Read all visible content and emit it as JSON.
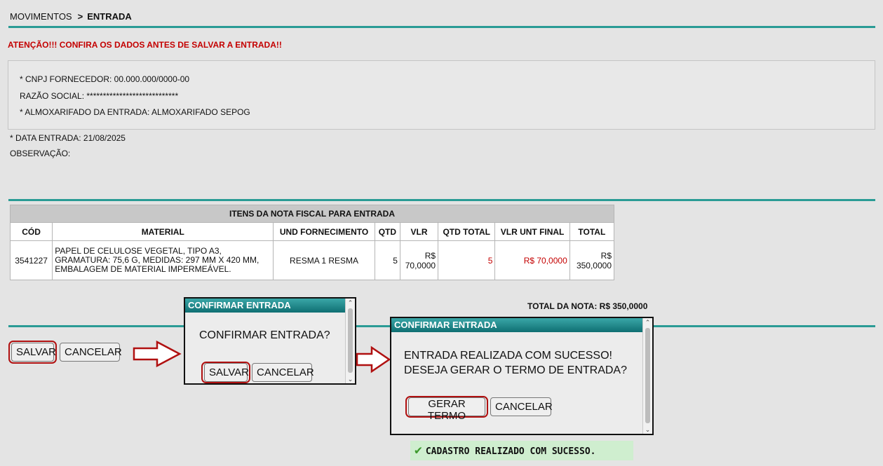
{
  "breadcrumb": {
    "root": "MOVIMENTOS",
    "separator": ">",
    "current": "ENTRADA"
  },
  "warning": "ATENÇÃO!!! CONFIRA OS DADOS ANTES DE SALVAR A ENTRADA!!",
  "info": {
    "cnpj": "* CNPJ FORNECEDOR: 00.000.000/0000-00",
    "razao_social": "RAZÃO SOCIAL: ****************************",
    "almoxarifado": "* ALMOXARIFADO DA ENTRADA: ALMOXARIFADO SEPOG"
  },
  "data_entrada": "* DATA ENTRADA: 21/08/2025",
  "observacao": "OBSERVAÇÃO:",
  "table": {
    "caption": "ITENS DA NOTA FISCAL PARA ENTRADA",
    "headers": [
      "CÓD",
      "MATERIAL",
      "UND FORNECIMENTO",
      "QTD",
      "VLR",
      "QTD TOTAL",
      "VLR UNT FINAL",
      "TOTAL"
    ],
    "rows": [
      {
        "cod": "3541227",
        "material": "PAPEL DE CELULOSE VEGETAL, TIPO A3, GRAMATURA: 75,6 G, MEDIDAS: 297 MM X 420 MM, EMBALAGEM DE MATERIAL IMPERMEÁVEL.",
        "und": "RESMA 1 RESMA",
        "qtd": "5",
        "vlr": "R$ 70,0000",
        "qtd_total": "5",
        "vlr_unt_final": "R$ 70,0000",
        "total": "R$ 350,0000"
      }
    ]
  },
  "total_nota": "TOTAL DA NOTA: R$ 350,0000",
  "buttons": {
    "salvar": "SALVAR",
    "cancelar": "CANCELAR"
  },
  "dialog1": {
    "title": "CONFIRMAR ENTRADA",
    "message": "CONFIRMAR ENTRADA?",
    "ok": "SALVAR",
    "cancel": "CANCELAR"
  },
  "dialog2": {
    "title": "CONFIRMAR ENTRADA",
    "line1": "ENTRADA REALIZADA COM SUCESSO!",
    "line2": "DESEJA GERAR O TERMO DE ENTRADA?",
    "ok": "GERAR TERMO",
    "cancel": "CANCELAR"
  },
  "success_message": "CADASTRO REALIZADO COM SUCESSO.",
  "colors": {
    "accent": "#2a9b95",
    "warning": "#c40000",
    "highlight": "#b01010",
    "success_bg": "#cfeecf"
  }
}
